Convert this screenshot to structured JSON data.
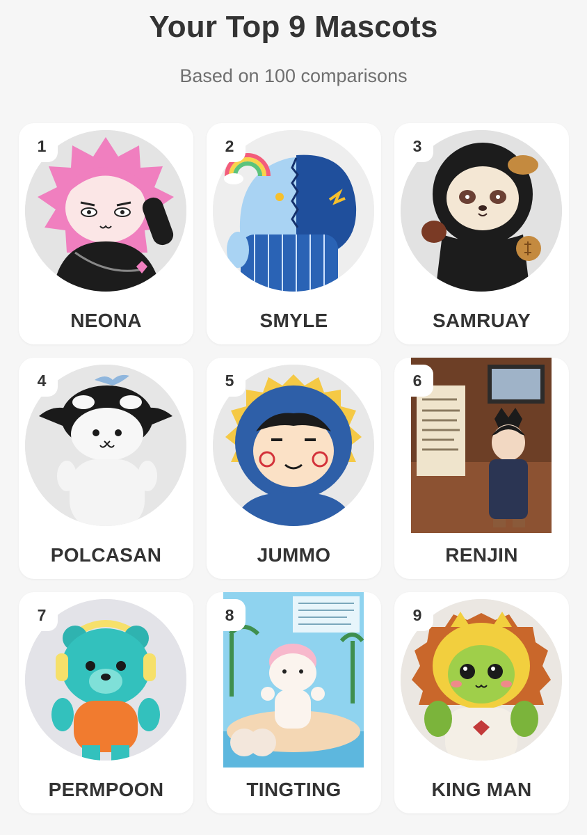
{
  "header": {
    "title": "Your Top 9 Mascots",
    "subtitle": "Based on 100 comparisons"
  },
  "mascots": [
    {
      "rank": "1",
      "name": "NEONA"
    },
    {
      "rank": "2",
      "name": "SMYLE"
    },
    {
      "rank": "3",
      "name": "SAMRUAY"
    },
    {
      "rank": "4",
      "name": "POLCASAN"
    },
    {
      "rank": "5",
      "name": "JUMMO"
    },
    {
      "rank": "6",
      "name": "RENJIN"
    },
    {
      "rank": "7",
      "name": "PERMPOON"
    },
    {
      "rank": "8",
      "name": "TINGTING"
    },
    {
      "rank": "9",
      "name": "KING MAN"
    }
  ],
  "colors": {
    "background": "#f6f6f6",
    "card": "#ffffff",
    "title_text": "#333333",
    "subtitle_text": "#6f6f6f"
  }
}
